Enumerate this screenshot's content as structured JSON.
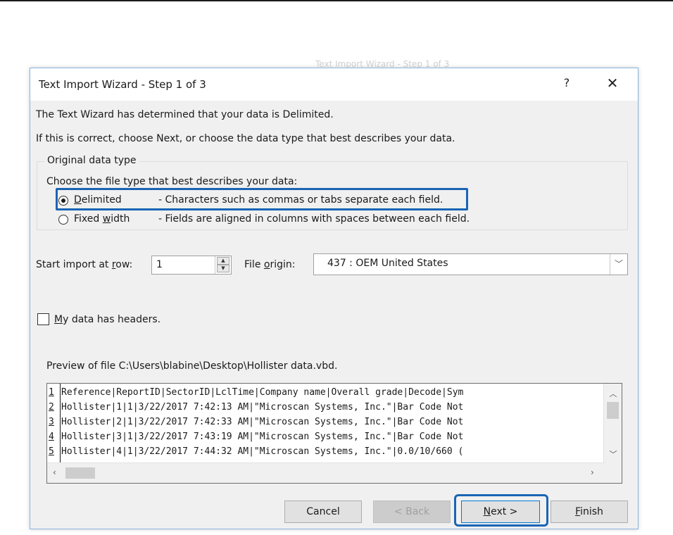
{
  "background": {
    "partial_text_top": "Text Import Wizard - Step 1 of 3"
  },
  "dialog": {
    "title": "Text Import Wizard - Step 1 of 3",
    "help_glyph": "?",
    "close_glyph": "✕",
    "message_line1": "The Text Wizard has determined that your data is Delimited.",
    "message_line2": "If this is correct, choose Next, or choose the data type that best describes your data.",
    "data_type_group": {
      "legend": "Original data type",
      "prompt": "Choose the file type that best describes your data:",
      "options": [
        {
          "label_underlined": "D",
          "label_rest": "elimited",
          "description": "- Characters such as commas or tabs separate each field.",
          "selected": true
        },
        {
          "label_before": "Fixed ",
          "label_underlined": "w",
          "label_rest": "idth",
          "description": "- Fields are aligned in columns with spaces between each field.",
          "selected": false
        }
      ]
    },
    "start_row": {
      "label_before": "Start import at ",
      "label_underlined": "r",
      "label_after": "ow:",
      "value": "1"
    },
    "file_origin": {
      "label_before": "File ",
      "label_underlined": "o",
      "label_after": "rigin:",
      "value": "437 : OEM United States"
    },
    "headers_checkbox": {
      "label_underlined": "M",
      "label_rest": "y data has headers.",
      "checked": false
    },
    "preview": {
      "label": "Preview of file C:\\Users\\blabine\\Desktop\\Hollister data.vbd.",
      "lines": [
        {
          "num": "1",
          "text": "Reference|ReportID|SectorID|LclTime|Company name|Overall grade|Decode|Sym"
        },
        {
          "num": "2",
          "text": "Hollister|1|1|3/22/2017 7:42:13 AM|\"Microscan Systems, Inc.\"|Bar Code Not"
        },
        {
          "num": "3",
          "text": "Hollister|2|1|3/22/2017 7:42:33 AM|\"Microscan Systems, Inc.\"|Bar Code Not"
        },
        {
          "num": "4",
          "text": "Hollister|3|1|3/22/2017 7:43:19 AM|\"Microscan Systems, Inc.\"|Bar Code Not"
        },
        {
          "num": "5",
          "text": "Hollister|4|1|3/22/2017 7:44:32 AM|\"Microscan Systems, Inc.\"|0.0/10/660 ("
        }
      ]
    },
    "buttons": {
      "cancel": "Cancel",
      "back": "< Back",
      "next_underlined": "N",
      "next_rest": "ext >",
      "finish_underlined": "F",
      "finish_rest": "inish"
    }
  },
  "colors": {
    "highlight": "#1a64b4",
    "dialog_bg": "#f0f0f0"
  }
}
